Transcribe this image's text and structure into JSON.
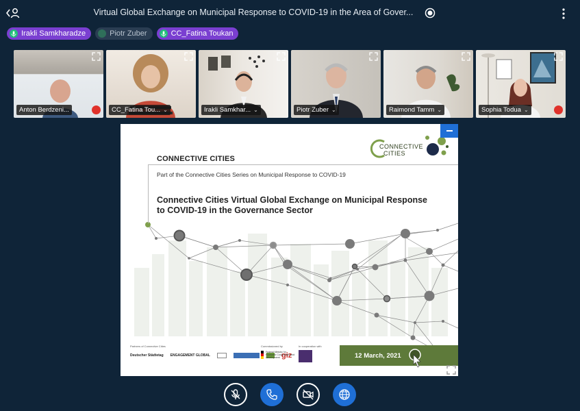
{
  "meeting": {
    "title": "Virtual Global Exchange on Municipal Response to COVID-19 in the Area of Gover..."
  },
  "speakers": [
    {
      "name": "Irakli Samkharadze",
      "state": "active"
    },
    {
      "name": "Piotr Zuber",
      "state": "inactive"
    },
    {
      "name": "CC_Fatina Toukan",
      "state": "active"
    }
  ],
  "participants": [
    {
      "name": "Anton Berdzeni...",
      "muted": true,
      "selected": false
    },
    {
      "name": "CC_Fatina Tou...",
      "muted": false,
      "selected": true
    },
    {
      "name": "Irakli Samkhar...",
      "muted": false,
      "selected": true
    },
    {
      "name": "Piotr Zuber",
      "muted": false,
      "selected": false
    },
    {
      "name": "Raimond Tamm",
      "muted": false,
      "selected": false
    },
    {
      "name": "Sophia Todua",
      "muted": true,
      "selected": false
    }
  ],
  "slide": {
    "brand": "CONNECTIVE CITIES",
    "series": "Part of the Connective Cities Series on Municipal Response to COVID-19",
    "heading_line1": "Connective Cities Virtual Global Exchange on Municipal Response",
    "heading_line2": "to COVID-19 in the Governance Sector",
    "logo_line1": "CONNECTIVE",
    "logo_line2": "CITIES",
    "date": "12 March, 2021",
    "partners_label": "Partners of Connective Cities",
    "commissioned_label": "Commissioned by",
    "cooperation_label": "In cooperation with",
    "partner_names": [
      "Deutscher Städtetag",
      "ENGAGEMENT GLOBAL",
      "giz"
    ],
    "commissioner_name": "Federal Ministry for Economic Cooperation and Development"
  },
  "colors": {
    "background": "#0f2438",
    "accent_blue": "#1f6fd6",
    "speaker_active": "#7a3fd1",
    "muted_red": "#e0322b",
    "slide_green": "#5e7a3a"
  },
  "controls": [
    {
      "icon": "mic-off-icon"
    },
    {
      "icon": "phone-icon"
    },
    {
      "icon": "video-off-icon"
    },
    {
      "icon": "globe-icon"
    }
  ]
}
